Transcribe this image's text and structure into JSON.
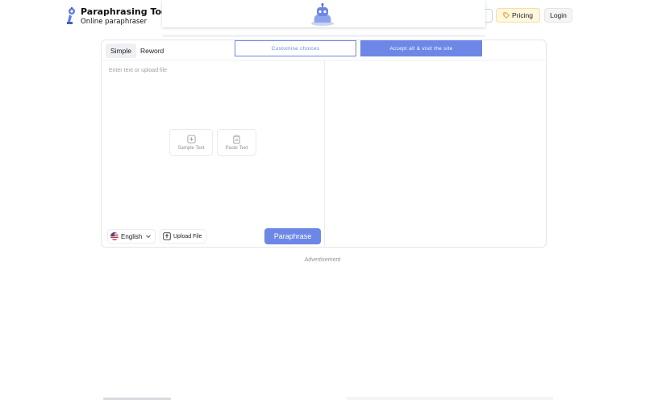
{
  "brand": {
    "title": "Paraphrasing Tool",
    "subtitle": "Online paraphraser"
  },
  "header": {
    "pricing_label": "Pricing",
    "login_label": "Login"
  },
  "tool": {
    "tabs": [
      {
        "label": "Simple",
        "active": true
      },
      {
        "label": "Reword",
        "active": false
      }
    ],
    "input_placeholder": "Enter text or upload file",
    "sample_text_label": "Sample Text",
    "paste_text_label": "Paste Text",
    "language_label": "English",
    "upload_label": "Upload File",
    "paraphrase_label": "Paraphrase"
  },
  "advertisement_label": "Advertisement",
  "consent": {
    "customise_label": "Customise choices",
    "accept_label": "Accept all & visit the site"
  },
  "colors": {
    "accent": "#6c87e6",
    "pricing_bg": "#fff7df"
  },
  "icons": {
    "logo": "robot-icon",
    "pricing": "tag-icon",
    "sample": "plus-square-icon",
    "paste": "clipboard-icon",
    "language": "us-flag-icon",
    "dropdown": "chevron-down-icon",
    "upload": "upload-icon"
  }
}
